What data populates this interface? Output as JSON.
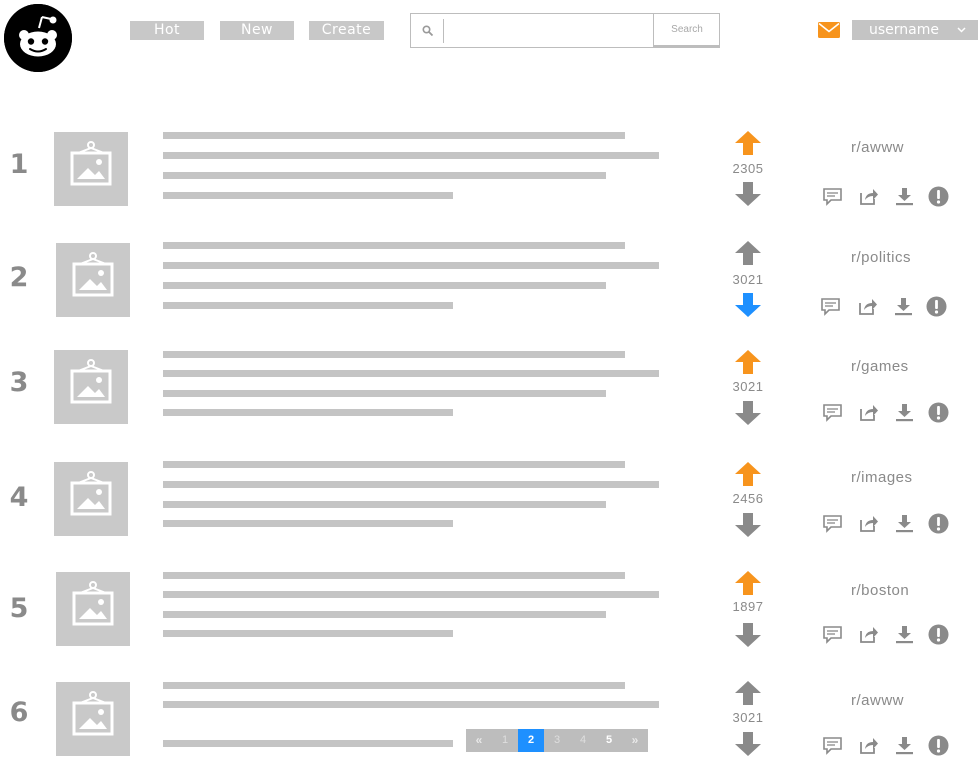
{
  "header": {
    "logo": "reddit-alien-logo",
    "nav": [
      {
        "label": "Hot"
      },
      {
        "label": "New"
      },
      {
        "label": "Create"
      }
    ],
    "search": {
      "placeholder": "",
      "button_label": "Search"
    },
    "mail_icon": "envelope-icon",
    "user": {
      "label": "username"
    }
  },
  "colors": {
    "upvote": "#f7941d",
    "downvote_active": "#1e90ff",
    "neutral": "#8a8a8a",
    "placeholder": "#c4c4c4",
    "pager_current": "#1e90ff"
  },
  "posts": [
    {
      "rank": "1",
      "score": "2305",
      "subreddit": "r/awww",
      "vote": "up"
    },
    {
      "rank": "2",
      "score": "3021",
      "subreddit": "r/politics",
      "vote": "down"
    },
    {
      "rank": "3",
      "score": "3021",
      "subreddit": "r/games",
      "vote": "up"
    },
    {
      "rank": "4",
      "score": "2456",
      "subreddit": "r/images",
      "vote": "up"
    },
    {
      "rank": "5",
      "score": "1897",
      "subreddit": "r/boston",
      "vote": "up"
    },
    {
      "rank": "6",
      "score": "3021",
      "subreddit": "r/awww",
      "vote": "none"
    }
  ],
  "post_actions": [
    "comment-icon",
    "share-icon",
    "download-icon",
    "report-icon"
  ],
  "pagination": {
    "first": "«",
    "pages": [
      "1",
      "2",
      "3",
      "4",
      "5"
    ],
    "current": "2",
    "last": "»"
  }
}
